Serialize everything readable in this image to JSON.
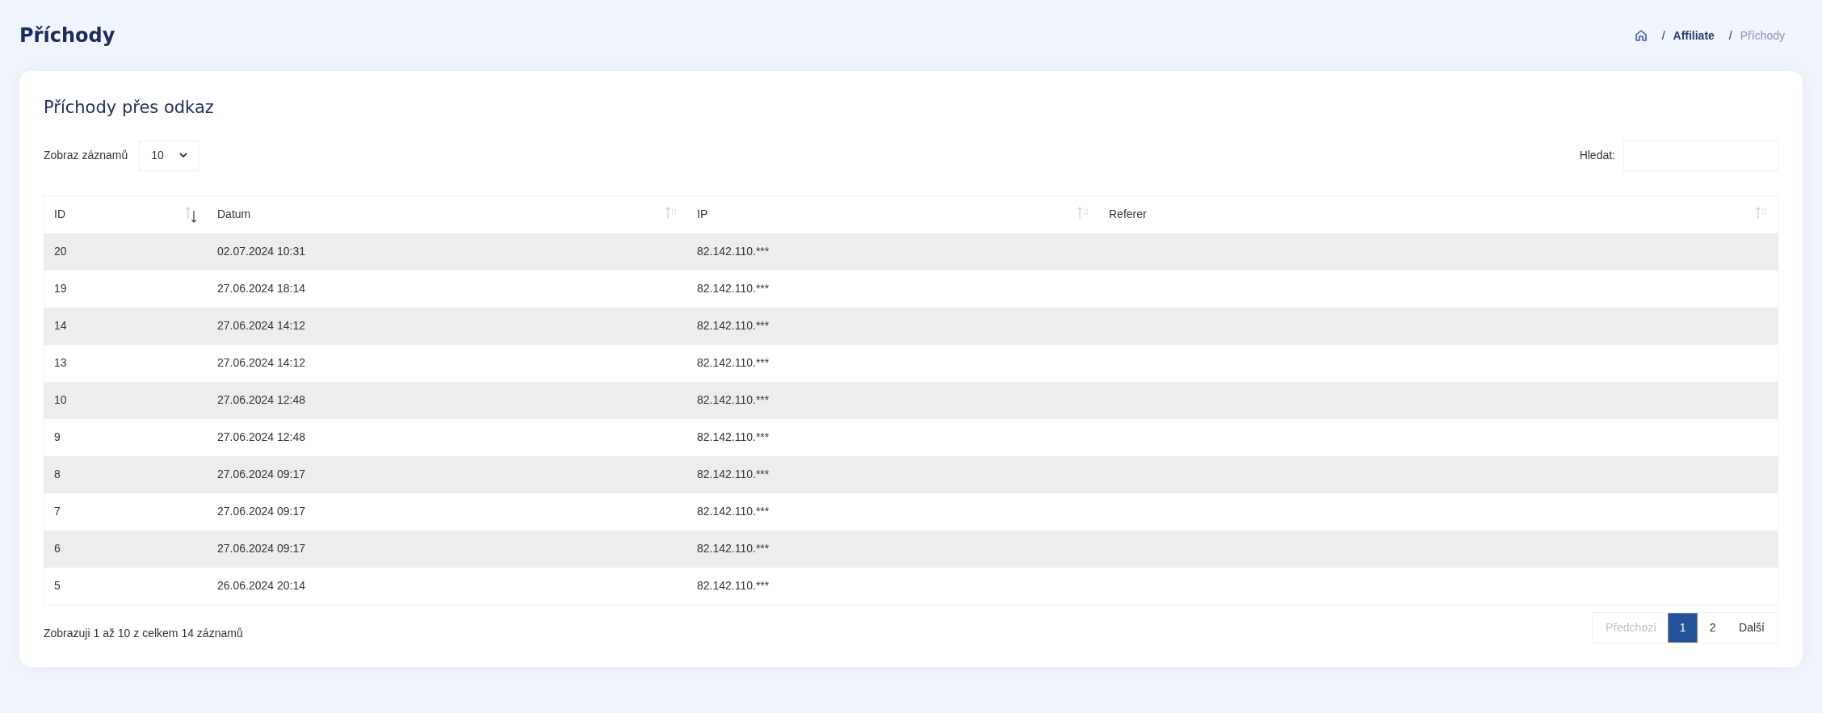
{
  "page_title": "Příchody",
  "breadcrumb": [
    {
      "separator": "/",
      "label": "Affiliate",
      "current": false
    },
    {
      "separator": "/",
      "label": "Příchody",
      "current": true
    }
  ],
  "card": {
    "title": "Příchody přes odkaz",
    "length_label": "Zobraz záznamů",
    "length_value": "10",
    "search_label": "Hledat:",
    "table": {
      "columns": [
        {
          "label": "ID",
          "sorted": true
        },
        {
          "label": "Datum",
          "sorted": false
        },
        {
          "label": "IP",
          "sorted": false
        },
        {
          "label": "Referer",
          "sorted": false
        }
      ],
      "rows": [
        [
          "20",
          "02.07.2024 10:31",
          "82.142.110.***"
        ],
        [
          "19",
          "27.06.2024 18:14",
          "82.142.110.***"
        ],
        [
          "14",
          "27.06.2024 14:12",
          "82.142.110.***"
        ],
        [
          "13",
          "27.06.2024 14:12",
          "82.142.110.***"
        ],
        [
          "10",
          "27.06.2024 12:48",
          "82.142.110.***"
        ],
        [
          "9",
          "27.06.2024 12:48",
          "82.142.110.***"
        ],
        [
          "8",
          "27.06.2024 09:17",
          "82.142.110.***"
        ],
        [
          "7",
          "27.06.2024 09:17",
          "82.142.110.***"
        ],
        [
          "6",
          "27.06.2024 09:17",
          "82.142.110.***"
        ],
        [
          "5",
          "26.06.2024 20:14",
          "82.142.110.***"
        ]
      ]
    },
    "info": "Zobrazuji 1 až 10 z celkem 14 záznamů",
    "pagination": {
      "previous": {
        "label": "Předchozí",
        "disabled": true
      },
      "pages": [
        {
          "label": "1",
          "selected": true
        },
        {
          "label": "2",
          "selected": false
        }
      ],
      "next": {
        "label": "Další",
        "disabled": false
      }
    }
  }
}
